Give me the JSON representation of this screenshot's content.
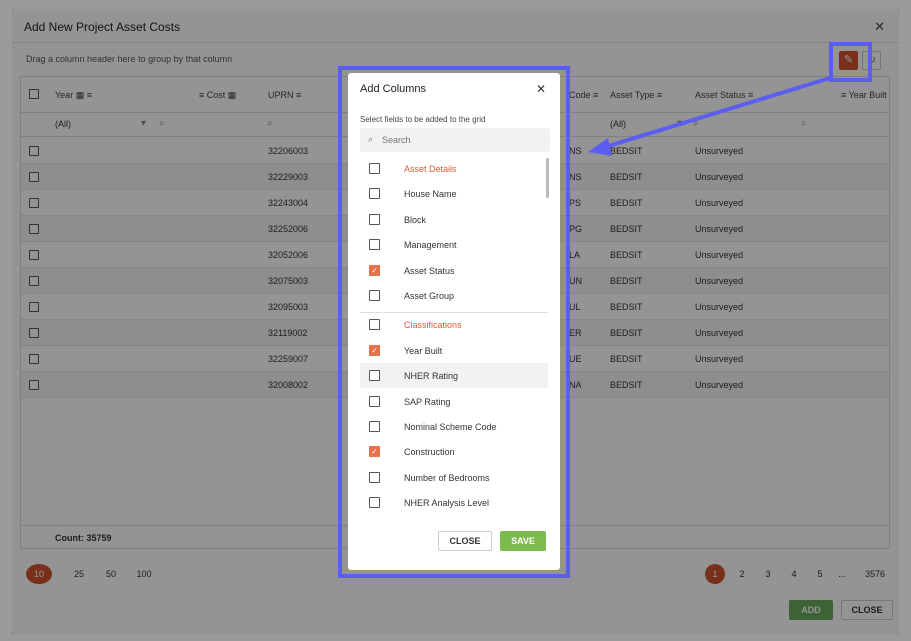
{
  "modal": {
    "title": "Add New Project Asset Costs",
    "group_hint": "Drag a column header here to group by that column"
  },
  "grid": {
    "columns": [
      "Year",
      "Cost",
      "UPRN",
      "Code",
      "Asset Type",
      "Asset Status",
      "Year Built"
    ],
    "filters": {
      "year": "(All)",
      "asset_type": "(All)"
    },
    "rows": [
      {
        "uprn": "32206003",
        "code": "NS",
        "asset_type": "BEDSIT",
        "asset_status": "Unsurveyed"
      },
      {
        "uprn": "32229003",
        "code": "NS",
        "asset_type": "BEDSIT",
        "asset_status": "Unsurveyed"
      },
      {
        "uprn": "32243004",
        "code": "PS",
        "asset_type": "BEDSIT",
        "asset_status": "Unsurveyed"
      },
      {
        "uprn": "32252006",
        "code": "PG",
        "asset_type": "BEDSIT",
        "asset_status": "Unsurveyed"
      },
      {
        "uprn": "32052006",
        "code": "LA",
        "asset_type": "BEDSIT",
        "asset_status": "Unsurveyed"
      },
      {
        "uprn": "32075003",
        "code": "UN",
        "asset_type": "BEDSIT",
        "asset_status": "Unsurveyed"
      },
      {
        "uprn": "32095003",
        "code": "UL",
        "asset_type": "BEDSIT",
        "asset_status": "Unsurveyed"
      },
      {
        "uprn": "32119002",
        "code": "ER",
        "asset_type": "BEDSIT",
        "asset_status": "Unsurveyed"
      },
      {
        "uprn": "32259007",
        "code": "UE",
        "asset_type": "BEDSIT",
        "asset_status": "Unsurveyed"
      },
      {
        "uprn": "32008002",
        "code": "NA",
        "asset_type": "BEDSIT",
        "asset_status": "Unsurveyed"
      }
    ],
    "count_label": "Count: 35759"
  },
  "pager": {
    "sizes": [
      "10",
      "25",
      "50",
      "100"
    ],
    "pages": [
      "1",
      "2",
      "3",
      "4",
      "5",
      "...",
      "3576"
    ]
  },
  "actions": {
    "add": "ADD",
    "close": "CLOSE"
  },
  "dialog": {
    "title": "Add Columns",
    "subtitle": "Select fields to be added to the grid",
    "search_placeholder": "Search",
    "fields": [
      {
        "label": "Asset Details",
        "category": true,
        "checked": false
      },
      {
        "label": "House Name",
        "category": false,
        "checked": false
      },
      {
        "label": "Block",
        "category": false,
        "checked": false
      },
      {
        "label": "Management",
        "category": false,
        "checked": false
      },
      {
        "label": "Asset Status",
        "category": false,
        "checked": true
      },
      {
        "label": "Asset Group",
        "category": false,
        "checked": false
      },
      {
        "label": "Classifications",
        "category": true,
        "checked": false
      },
      {
        "label": "Year Built",
        "category": false,
        "checked": true
      },
      {
        "label": "NHER Rating",
        "category": false,
        "checked": false
      },
      {
        "label": "SAP Rating",
        "category": false,
        "checked": false
      },
      {
        "label": "Nominal Scheme Code",
        "category": false,
        "checked": false
      },
      {
        "label": "Construction",
        "category": false,
        "checked": true
      },
      {
        "label": "Number of Bedrooms",
        "category": false,
        "checked": false
      },
      {
        "label": "NHER Analysis Level",
        "category": false,
        "checked": false
      }
    ],
    "close_label": "CLOSE",
    "save_label": "SAVE"
  },
  "colors": {
    "accent": "#d0532f",
    "highlight": "#5b5ef0",
    "save": "#7dbb4f",
    "add": "#6aaa5a"
  }
}
